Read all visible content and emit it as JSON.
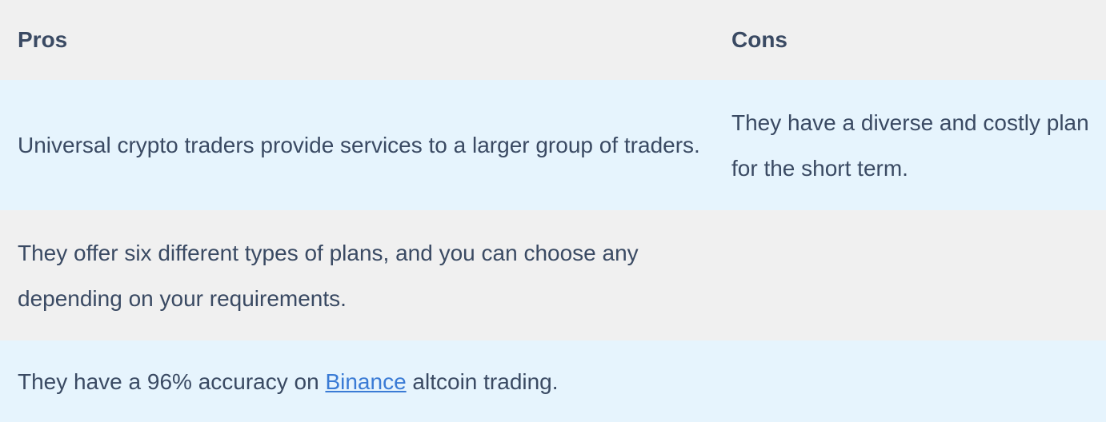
{
  "headers": {
    "pros": "Pros",
    "cons": "Cons"
  },
  "rows": [
    {
      "pros": "Universal crypto traders provide services to a larger group of traders.",
      "cons": "They have a diverse and costly plan for the short term."
    },
    {
      "pros": "They offer six different types of plans, and you can choose any depending on your requirements.",
      "cons": ""
    },
    {
      "pros_before": "They have a 96% accuracy on ",
      "pros_link": "Binance",
      "pros_after": " altcoin trading.",
      "cons": ""
    }
  ],
  "colors": {
    "text": "#3a4a63",
    "link": "#3a7bd5",
    "row_blue": "#e6f4fd",
    "row_gray": "#f0f0f0"
  }
}
